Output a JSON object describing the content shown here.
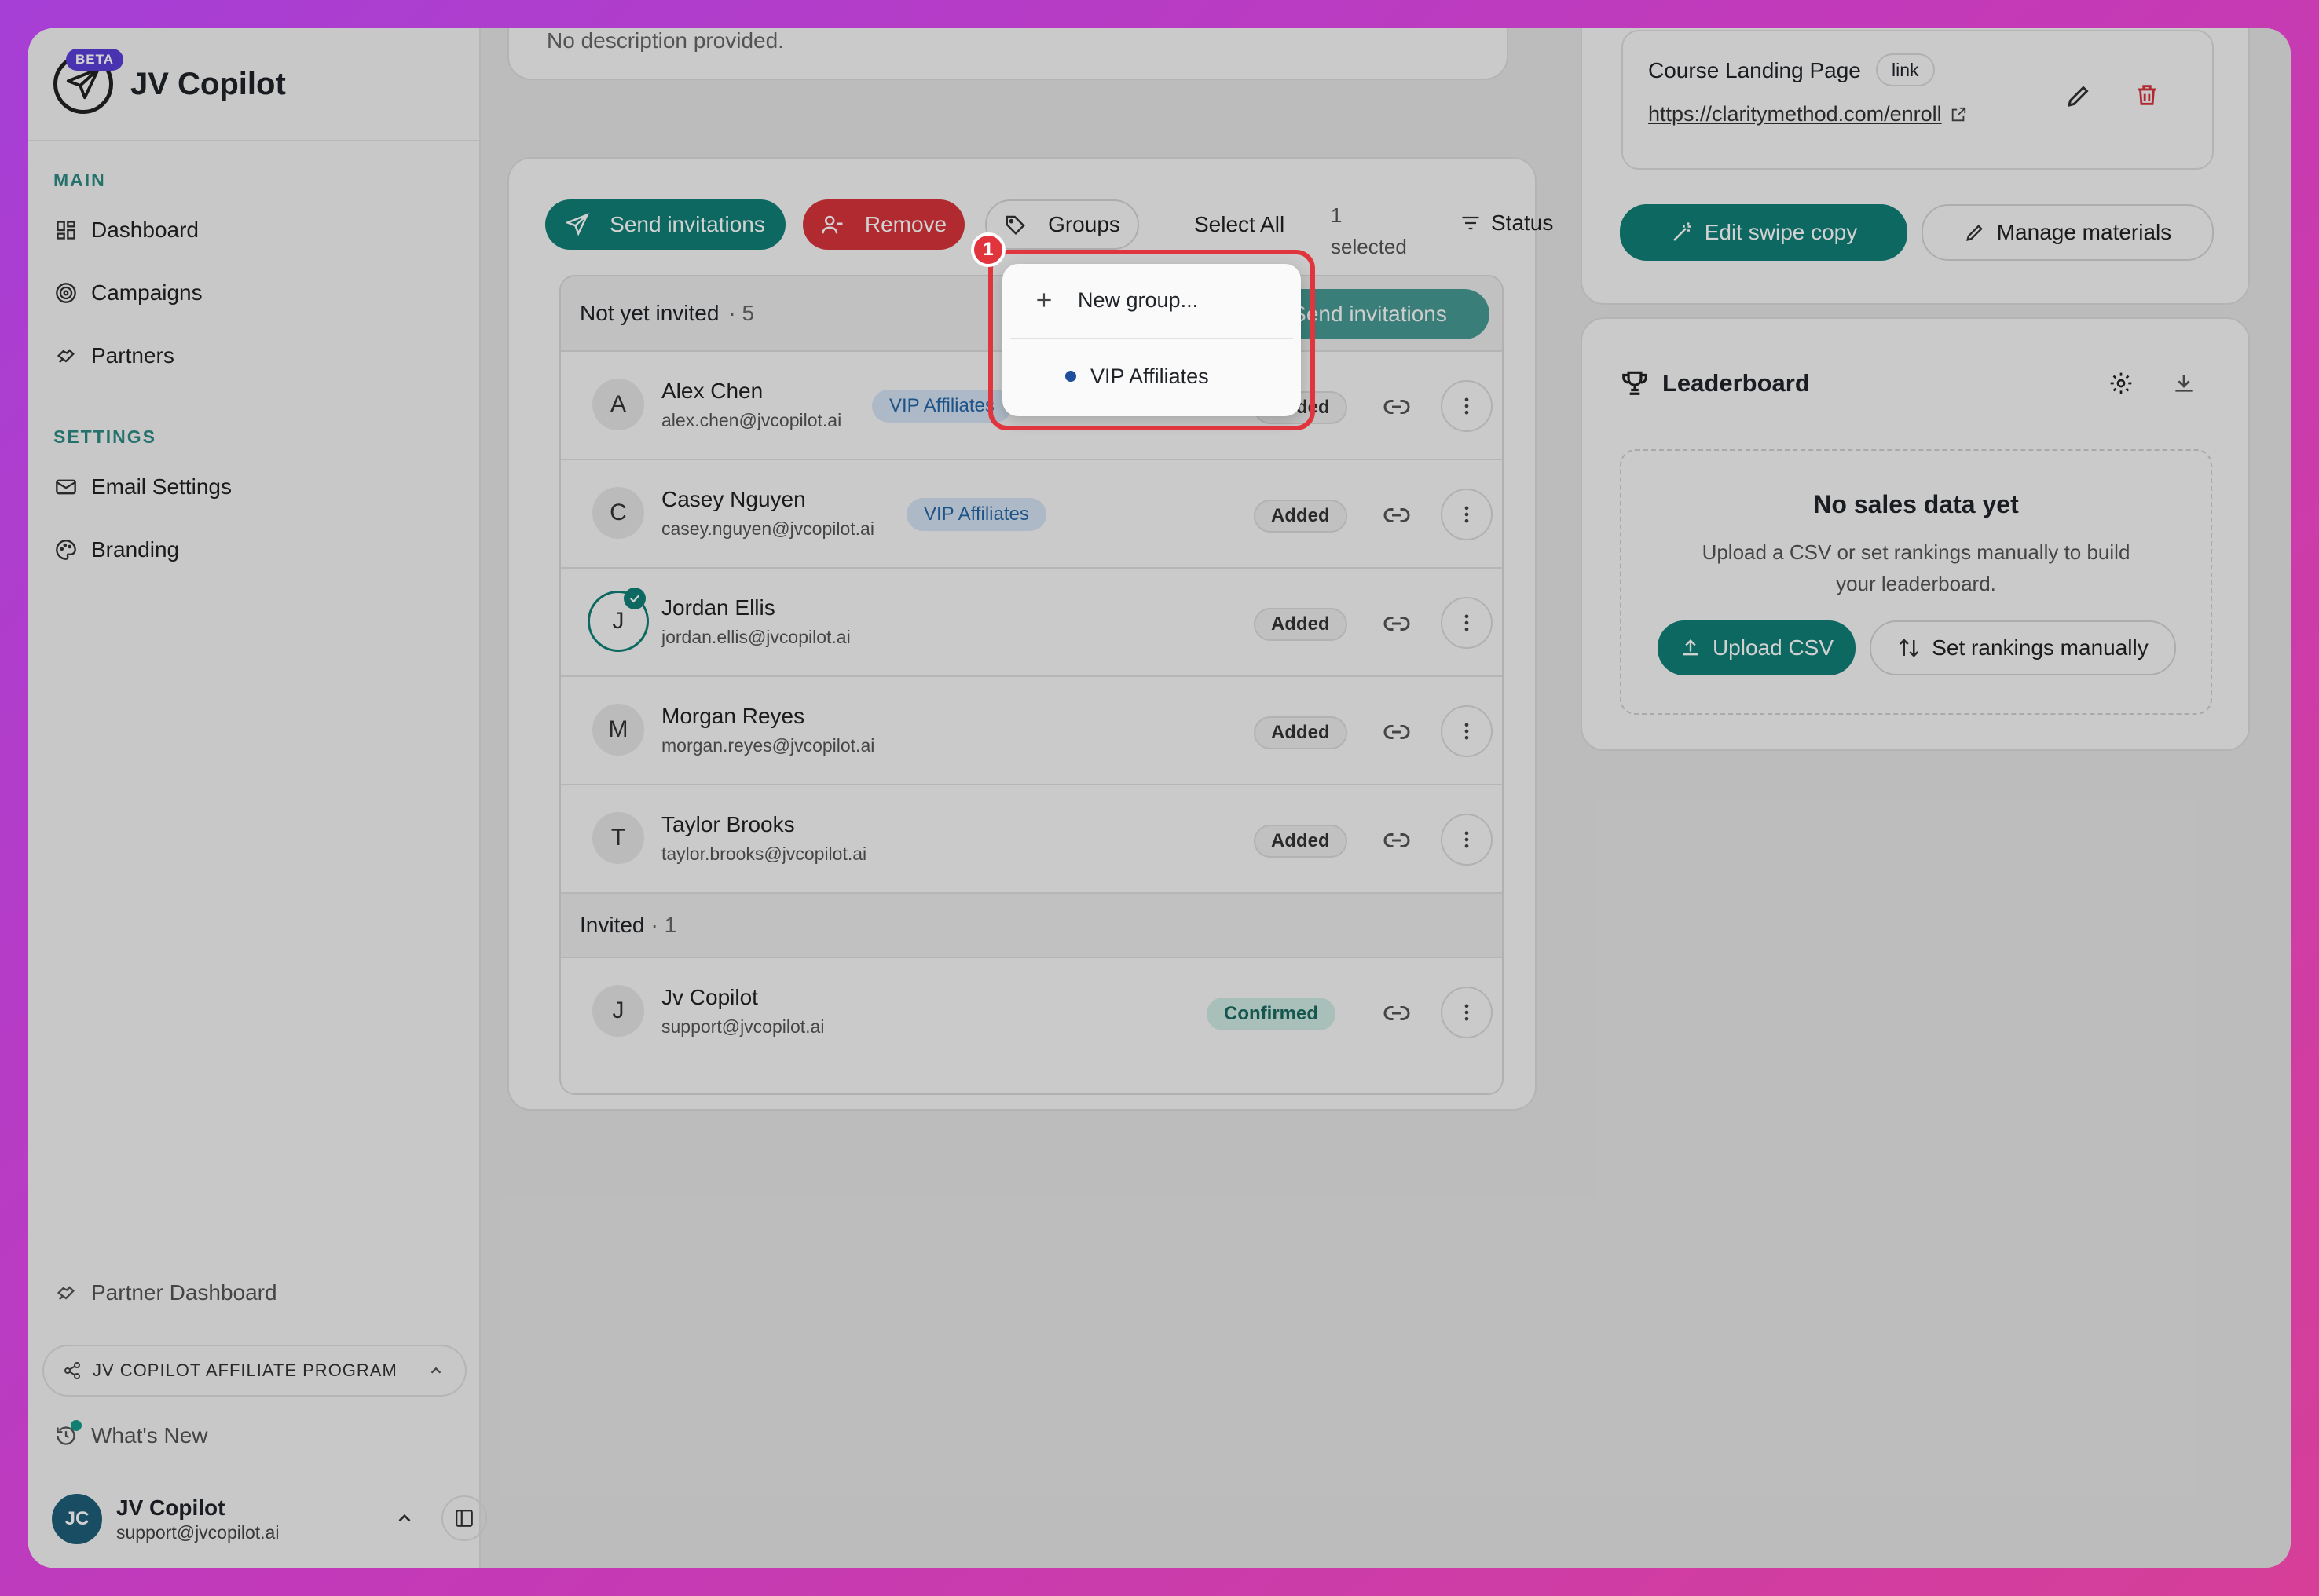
{
  "brand": {
    "name": "JV Copilot",
    "beta_label": "BETA"
  },
  "sidebar": {
    "main_label": "MAIN",
    "main_items": [
      {
        "label": "Dashboard",
        "icon": "dashboard-icon"
      },
      {
        "label": "Campaigns",
        "icon": "target-icon"
      },
      {
        "label": "Partners",
        "icon": "handshake-icon"
      }
    ],
    "settings_label": "SETTINGS",
    "settings_items": [
      {
        "label": "Email Settings",
        "icon": "mail-icon"
      },
      {
        "label": "Branding",
        "icon": "palette-icon"
      }
    ],
    "partner_dashboard": "Partner Dashboard",
    "program_name": "JV COPILOT AFFILIATE PROGRAM",
    "whats_new": "What's New",
    "user": {
      "initials": "JC",
      "name": "JV Copilot",
      "email": "support@jvcopilot.ai"
    }
  },
  "top_card": {
    "description": "No description provided."
  },
  "toolbar": {
    "send_invitations": "Send invitations",
    "remove": "Remove",
    "groups": "Groups",
    "select_all": "Select All",
    "selected_count": "1",
    "selected_label": "selected",
    "status": "Status"
  },
  "groups_dropdown": {
    "new_group": "New group...",
    "items": [
      {
        "label": "VIP Affiliates",
        "color": "#1f4e9c"
      }
    ],
    "marker": "1"
  },
  "not_invited": {
    "label": "Not yet invited",
    "count": "· 5",
    "send_button": "Send invitations",
    "rows": [
      {
        "initial": "A",
        "name": "Alex Chen",
        "email": "alex.chen@jvcopilot.ai",
        "tag": "VIP Affiliates",
        "status": "Added"
      },
      {
        "initial": "C",
        "name": "Casey Nguyen",
        "email": "casey.nguyen@jvcopilot.ai",
        "tag": "VIP Affiliates",
        "status": "Added"
      },
      {
        "initial": "J",
        "name": "Jordan Ellis",
        "email": "jordan.ellis@jvcopilot.ai",
        "tag": "",
        "status": "Added"
      },
      {
        "initial": "M",
        "name": "Morgan Reyes",
        "email": "morgan.reyes@jvcopilot.ai",
        "tag": "",
        "status": "Added"
      },
      {
        "initial": "T",
        "name": "Taylor Brooks",
        "email": "taylor.brooks@jvcopilot.ai",
        "tag": "",
        "status": "Added"
      }
    ]
  },
  "invited": {
    "label": "Invited",
    "count": "· 1",
    "rows": [
      {
        "initial": "J",
        "name": "Jv Copilot",
        "email": "support@jvcopilot.ai",
        "status": "Confirmed"
      }
    ]
  },
  "materials": {
    "item_title": "Course Landing Page",
    "item_type": "link",
    "item_url": "https://claritymethod.com/enroll",
    "edit_swipe": "Edit swipe copy",
    "manage": "Manage materials"
  },
  "leaderboard": {
    "title": "Leaderboard",
    "empty_title": "No sales data yet",
    "empty_desc_1": "Upload a CSV or set rankings manually to build",
    "empty_desc_2": "your leaderboard.",
    "upload_csv": "Upload CSV",
    "set_rankings": "Set rankings manually"
  },
  "colors": {
    "teal": "#0f7f76",
    "red": "#d7343b",
    "highlight": "#e0353d"
  }
}
